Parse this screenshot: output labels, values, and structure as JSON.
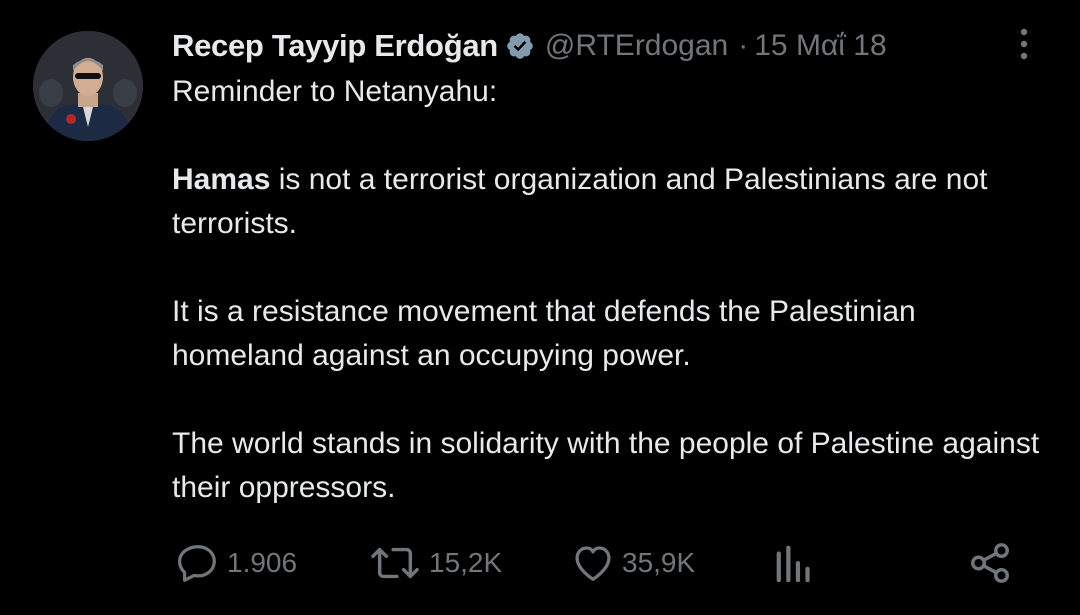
{
  "tweet": {
    "author_name": "Recep Tayyip Erdoğan",
    "handle": "@RTErdogan",
    "separator": "·",
    "date": "15 Μαΐ 18",
    "verified_icon": "verified-badge-icon",
    "more_icon": "more-vertical-icon",
    "text": {
      "line1": "Reminder to Netanyahu:",
      "p2_bold": "Hamas",
      "p2_rest": " is not a terrorist organization and Palestinians are not terrorists.",
      "p3": "It is a resistance movement that defends the Palestinian homeland against an occupying power.",
      "p4": "The world stands in solidarity with the people of Palestine against their oppressors."
    },
    "actions": {
      "replies": "1.906",
      "retweets": "15,2K",
      "likes": "35,9K"
    }
  },
  "colors": {
    "background": "#000000",
    "text": "#e7e9ea",
    "muted": "#71767b",
    "verified": "#829aab"
  }
}
